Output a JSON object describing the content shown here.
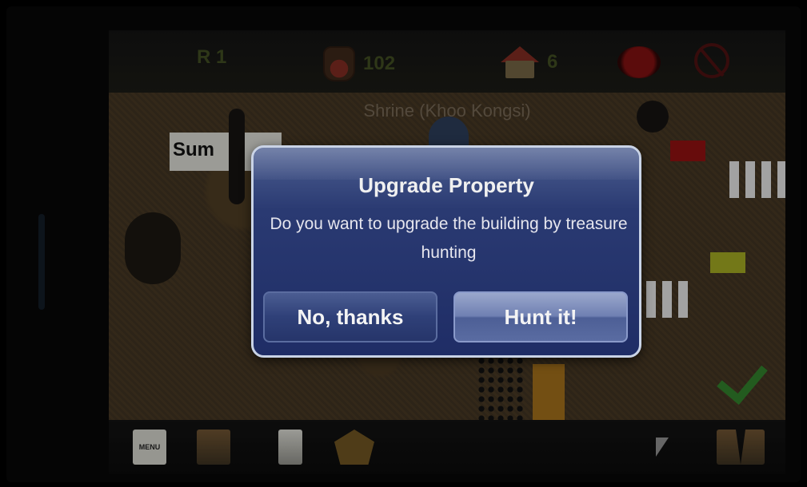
{
  "hud": {
    "left_value": "R 1",
    "coins": "102",
    "houses": "6"
  },
  "map": {
    "location_title": "Shrine (Khoo Kongsi)",
    "label_fragment": "Sum"
  },
  "dialog": {
    "title": "Upgrade Property",
    "message": "Do you want to upgrade the building by treasure hunting",
    "cancel_label": "No, thanks",
    "confirm_label": "Hunt it!"
  },
  "toolbar": {
    "menu_label": "MENU"
  },
  "colors": {
    "dialog_bg": "#2a3a72",
    "dialog_border": "#c9d3e6",
    "map_bg": "#3f3220"
  }
}
